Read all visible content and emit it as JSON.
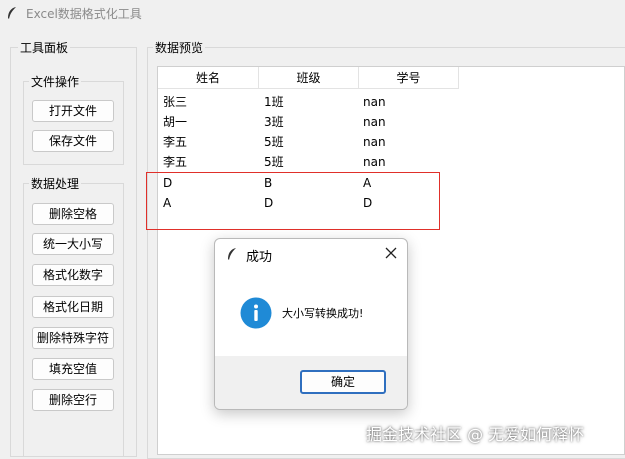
{
  "window": {
    "title": "Excel数据格式化工具",
    "icon": "feather-icon"
  },
  "toolbox": {
    "label": "工具面板",
    "file_ops": {
      "label": "文件操作",
      "buttons": [
        "打开文件",
        "保存文件"
      ]
    },
    "data_ops": {
      "label": "数据处理",
      "buttons": [
        "删除空格",
        "统一大小写",
        "格式化数字",
        "格式化日期",
        "删除特殊字符",
        "填充空值",
        "删除空行"
      ]
    }
  },
  "preview": {
    "label": "数据预览",
    "columns": [
      "姓名",
      "班级",
      "学号"
    ],
    "rows": [
      [
        "张三",
        "1班",
        "nan"
      ],
      [
        "胡一",
        "3班",
        "nan"
      ],
      [
        "李五",
        "5班",
        "nan"
      ],
      [
        "李五",
        "5班",
        "nan"
      ],
      [
        "D",
        "B",
        "A"
      ],
      [
        "A",
        "D",
        "D"
      ]
    ]
  },
  "dialog": {
    "title": "成功",
    "message": "大小写转换成功!",
    "ok_label": "确定",
    "icon": "info-icon"
  },
  "colors": {
    "highlight": "#e0302a",
    "info_blue": "#1f8ad6",
    "ok_border": "#2f6fbf"
  },
  "watermark": "掘金技术社区 @ 无爱如何释怀"
}
